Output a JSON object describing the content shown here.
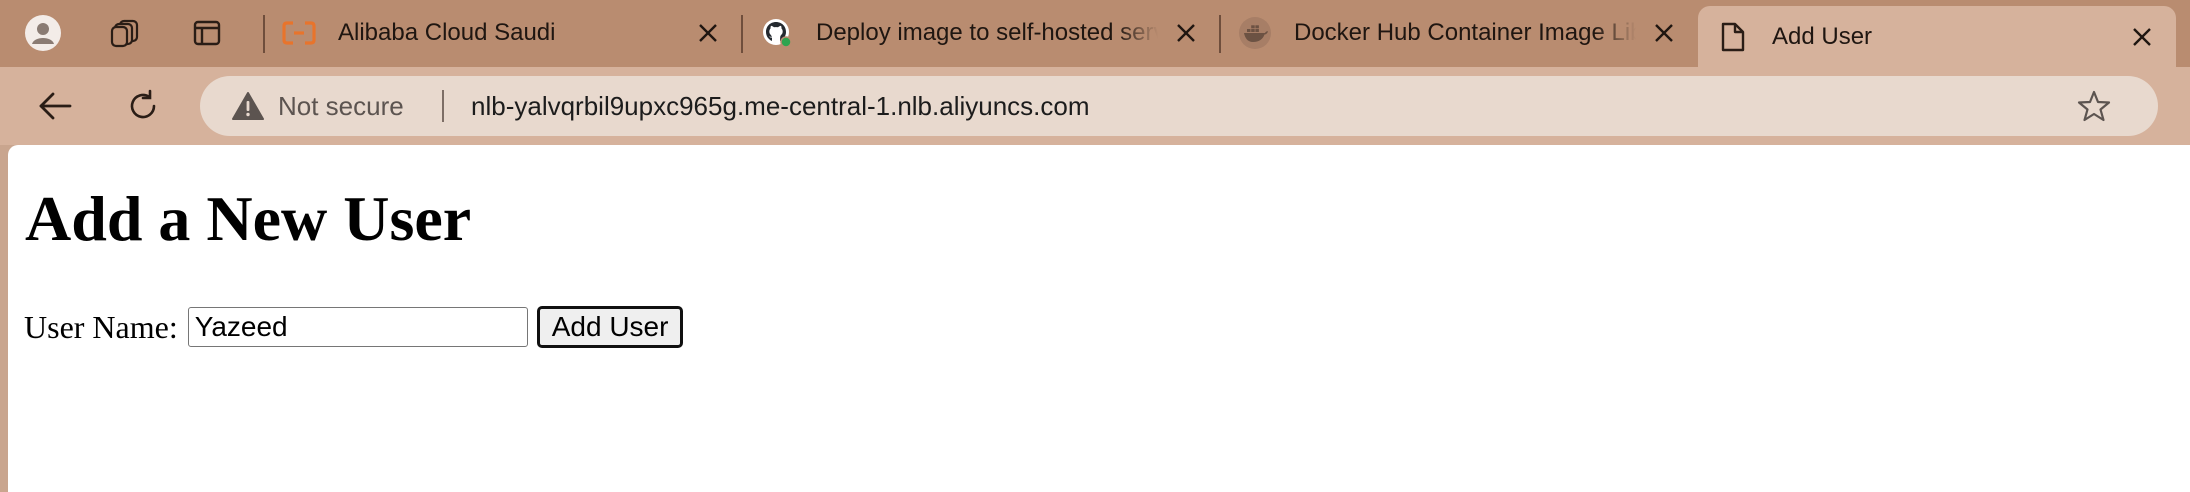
{
  "tabs": [
    {
      "title": "Alibaba Cloud Saudi",
      "icon": "alibaba-cloud-icon",
      "active": false
    },
    {
      "title": "Deploy image to self-hosted server",
      "icon": "github-icon",
      "active": false
    },
    {
      "title": "Docker Hub Container Image Library",
      "icon": "docker-icon",
      "active": false
    },
    {
      "title": "Add User",
      "icon": "page-icon",
      "active": true
    }
  ],
  "toolbar": {
    "security_label": "Not secure",
    "url": "nlb-yalvqrbil9upxc965g.me-central-1.nlb.aliyuncs.com"
  },
  "page": {
    "heading": "Add a New User",
    "form": {
      "label": "User Name:",
      "input_value": "Yazeed",
      "submit_label": "Add User"
    }
  },
  "colors": {
    "tab_strip": "#b98c70",
    "toolbar": "#d6b29c",
    "omnibox": "#e8d9ce",
    "alibaba_orange": "#e8742c",
    "page_background": "#ffffff"
  }
}
